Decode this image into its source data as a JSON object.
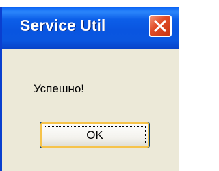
{
  "dialog": {
    "title": "Service Util",
    "message": "Успешно!",
    "ok_label": "OK",
    "close_icon": "close-x-icon"
  },
  "colors": {
    "titlebar": "#0a56df",
    "body": "#ece9d8",
    "close_button": "#e24d28"
  }
}
